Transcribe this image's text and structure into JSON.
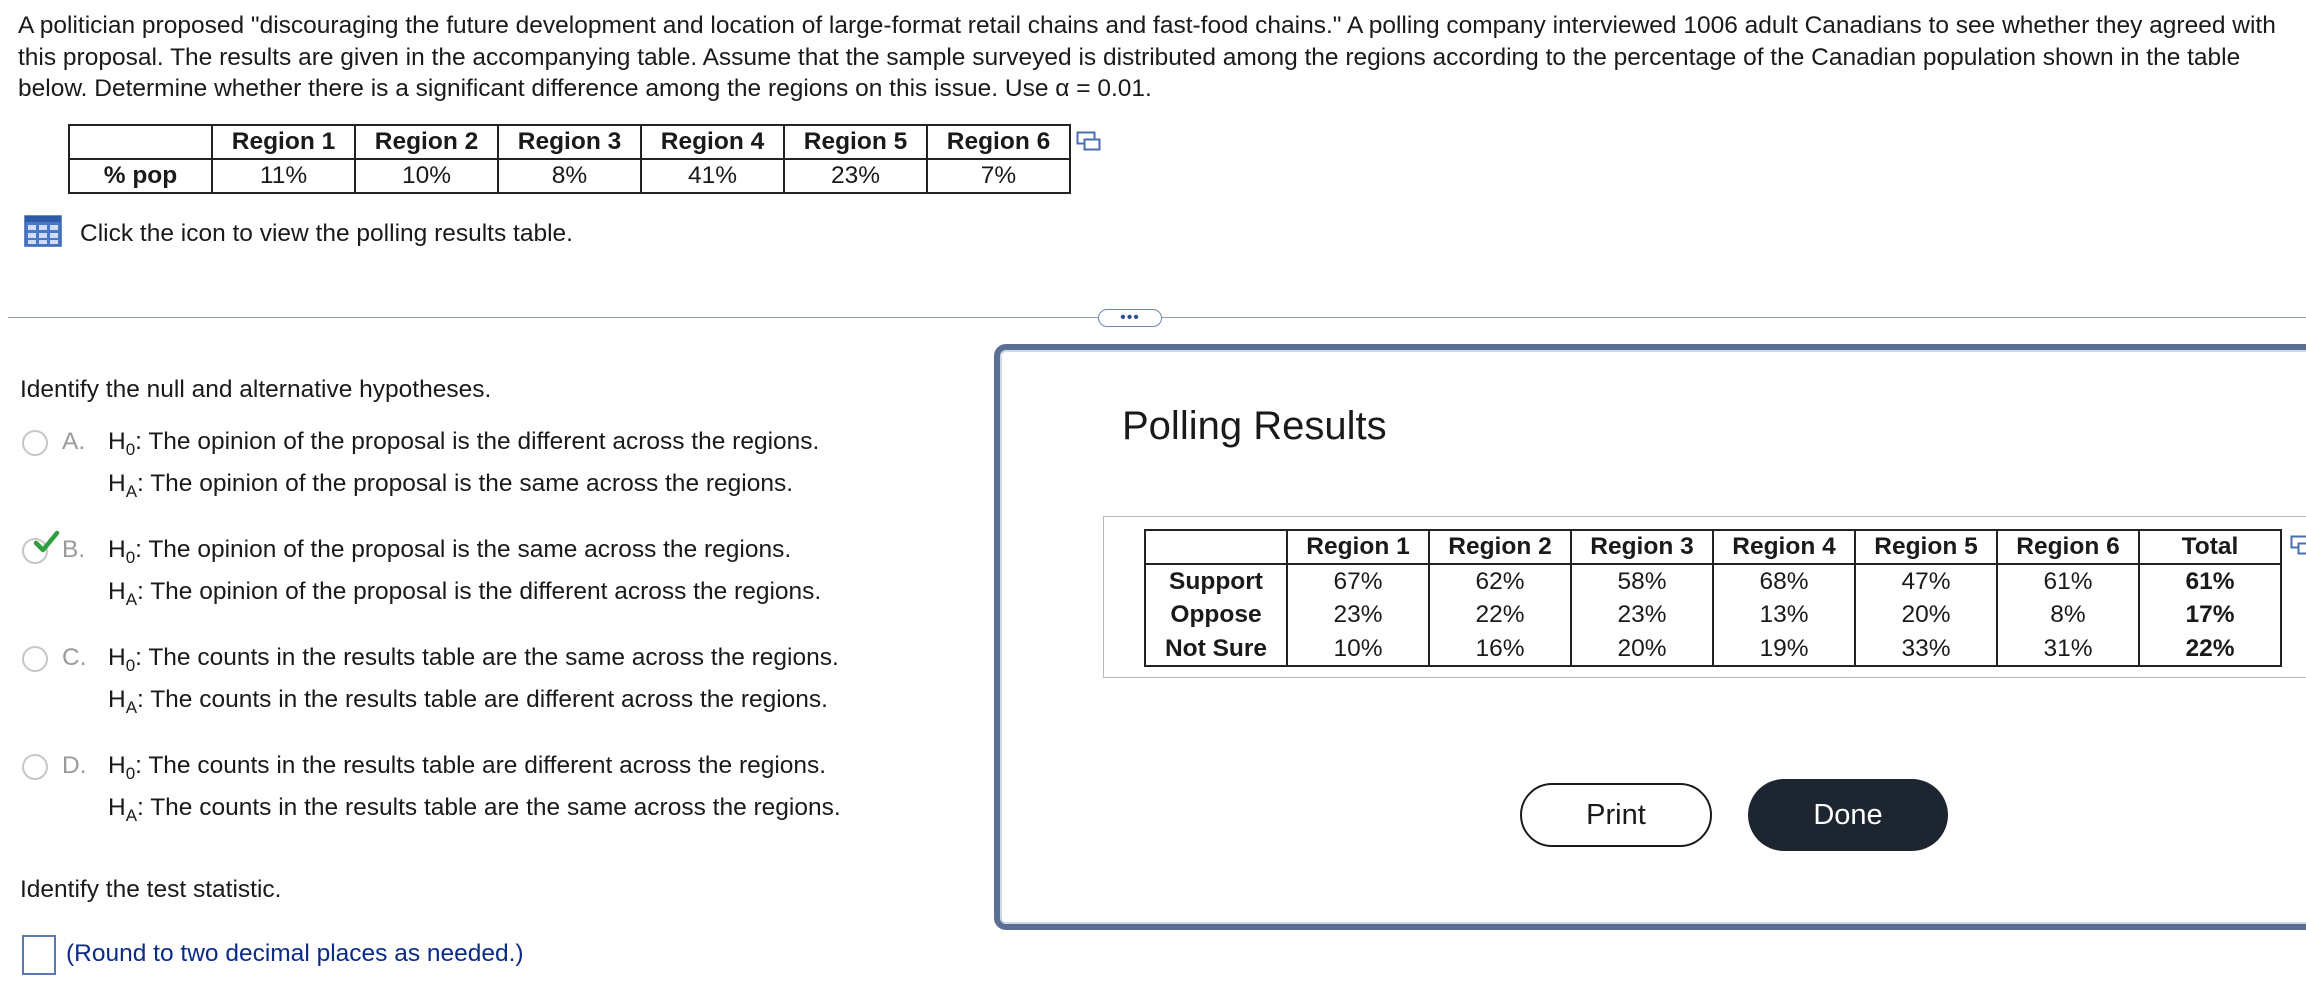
{
  "problem": {
    "text": "A politician proposed \"discouraging the future development and location of large-format retail chains and fast-food chains.\" A polling company interviewed 1006 adult Canadians to see whether they agreed with this proposal. The results are given in the accompanying table. Assume that the sample surveyed is distributed among the regions according to the percentage of the Canadian population shown in the table below. Determine whether there is a significant difference among the regions on this issue. Use α = 0.01."
  },
  "pop_table": {
    "headers": [
      "Region 1",
      "Region 2",
      "Region 3",
      "Region 4",
      "Region 5",
      "Region 6"
    ],
    "row_label": "% pop",
    "values": [
      "11%",
      "10%",
      "8%",
      "41%",
      "23%",
      "7%"
    ]
  },
  "table_link": {
    "text": "Click the icon to view the polling results table."
  },
  "more_button": {
    "label": "•••"
  },
  "question1": {
    "prompt": "Identify the null and alternative hypotheses.",
    "options": [
      {
        "letter": "A.",
        "h0_label": "H",
        "h0_sub": "0",
        "h0": ": The opinion of the proposal is the different across the regions.",
        "ha_label": "H",
        "ha_sub": "A",
        "ha": ": The opinion of the proposal is the same across the regions.",
        "selected": false
      },
      {
        "letter": "B.",
        "h0_label": "H",
        "h0_sub": "0",
        "h0": ": The opinion of the proposal is the same across the regions.",
        "ha_label": "H",
        "ha_sub": "A",
        "ha": ": The opinion of the proposal is the different across the regions.",
        "selected": true
      },
      {
        "letter": "C.",
        "h0_label": "H",
        "h0_sub": "0",
        "h0": ": The counts in the results table are the same across the regions.",
        "ha_label": "H",
        "ha_sub": "A",
        "ha": ": The counts in the results table are different across the regions.",
        "selected": false
      },
      {
        "letter": "D.",
        "h0_label": "H",
        "h0_sub": "0",
        "h0": ": The counts in the results table are different across the regions.",
        "ha_label": "H",
        "ha_sub": "A",
        "ha": ": The counts in the results table are the same across the regions.",
        "selected": false
      }
    ]
  },
  "question2": {
    "prompt": "Identify the test statistic.",
    "answer_value": "",
    "note": "(Round to two decimal places as needed.)"
  },
  "popup": {
    "title": "Polling Results",
    "headers": [
      "Region 1",
      "Region 2",
      "Region 3",
      "Region 4",
      "Region 5",
      "Region 6",
      "Total"
    ],
    "rows": [
      {
        "label": "Support",
        "values": [
          "67%",
          "62%",
          "58%",
          "68%",
          "47%",
          "61%",
          "61%"
        ]
      },
      {
        "label": "Oppose",
        "values": [
          "23%",
          "22%",
          "23%",
          "13%",
          "20%",
          "8%",
          "17%"
        ]
      },
      {
        "label": "Not Sure",
        "values": [
          "10%",
          "16%",
          "20%",
          "19%",
          "33%",
          "31%",
          "22%"
        ]
      }
    ],
    "print_label": "Print",
    "done_label": "Done"
  },
  "colors": {
    "link_blue": "#0b2b8a",
    "done_bg": "#1d2530",
    "check_green": "#2e9e3e",
    "popup_border": "#5a6f93"
  }
}
